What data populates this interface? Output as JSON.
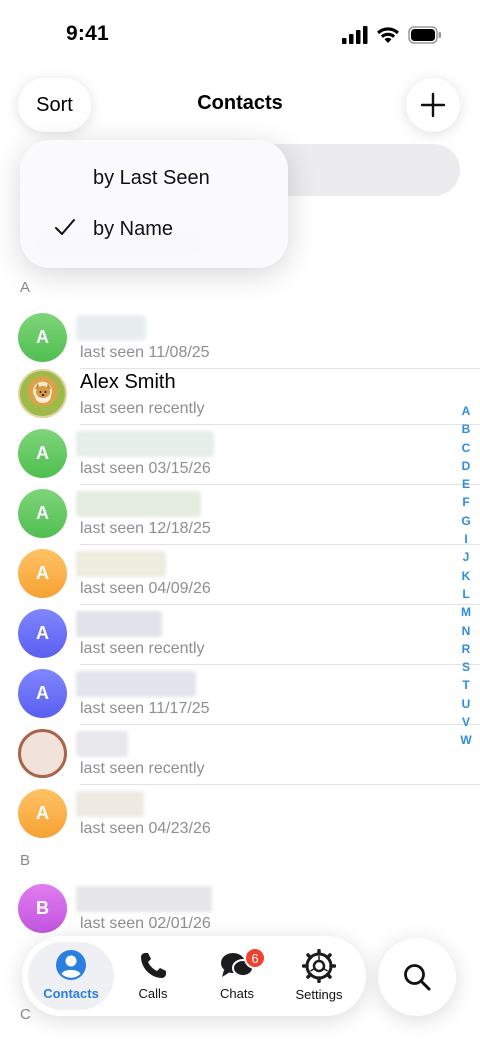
{
  "status_bar": {
    "time": "9:41"
  },
  "header": {
    "sort_label": "Sort",
    "title": "Contacts",
    "add_icon": "plus-icon"
  },
  "sort_menu": {
    "items": [
      {
        "label": "by Last Seen",
        "checked": false
      },
      {
        "label": "by Name",
        "checked": true
      }
    ]
  },
  "sections": [
    "A",
    "B",
    "C"
  ],
  "contacts": [
    {
      "initial": "A",
      "name": "",
      "status": "last seen 11/08/25",
      "color": "green"
    },
    {
      "initial": "",
      "name": "Alex Smith",
      "status": "last seen recently",
      "color": "photo"
    },
    {
      "initial": "A",
      "name": "",
      "status": "last seen 03/15/26",
      "color": "green"
    },
    {
      "initial": "A",
      "name": "",
      "status": "last seen 12/18/25",
      "color": "green"
    },
    {
      "initial": "A",
      "name": "",
      "status": "last seen 04/09/26",
      "color": "orange"
    },
    {
      "initial": "A",
      "name": "",
      "status": "last seen recently",
      "color": "blue"
    },
    {
      "initial": "A",
      "name": "",
      "status": "last seen 11/17/25",
      "color": "blue"
    },
    {
      "initial": "",
      "name": "",
      "status": "last seen recently",
      "color": "photo-brown"
    },
    {
      "initial": "A",
      "name": "",
      "status": "last seen 04/23/26",
      "color": "orange"
    },
    {
      "initial": "B",
      "name": "",
      "status": "last seen 02/01/26",
      "color": "purple"
    }
  ],
  "index_letters": [
    "A",
    "B",
    "C",
    "D",
    "E",
    "F",
    "G",
    "I",
    "J",
    "K",
    "L",
    "M",
    "N",
    "R",
    "S",
    "T",
    "U",
    "V",
    "W"
  ],
  "tabs": [
    {
      "label": "Contacts",
      "icon": "person-icon",
      "active": true
    },
    {
      "label": "Calls",
      "icon": "phone-icon",
      "active": false
    },
    {
      "label": "Chats",
      "icon": "chat-bubbles-icon",
      "active": false,
      "badge": "6"
    },
    {
      "label": "Settings",
      "icon": "gear-icon",
      "active": false
    }
  ],
  "colors": {
    "accent": "#2a7fe0",
    "badge": "#f0432f",
    "index": "#2d8ce4"
  }
}
